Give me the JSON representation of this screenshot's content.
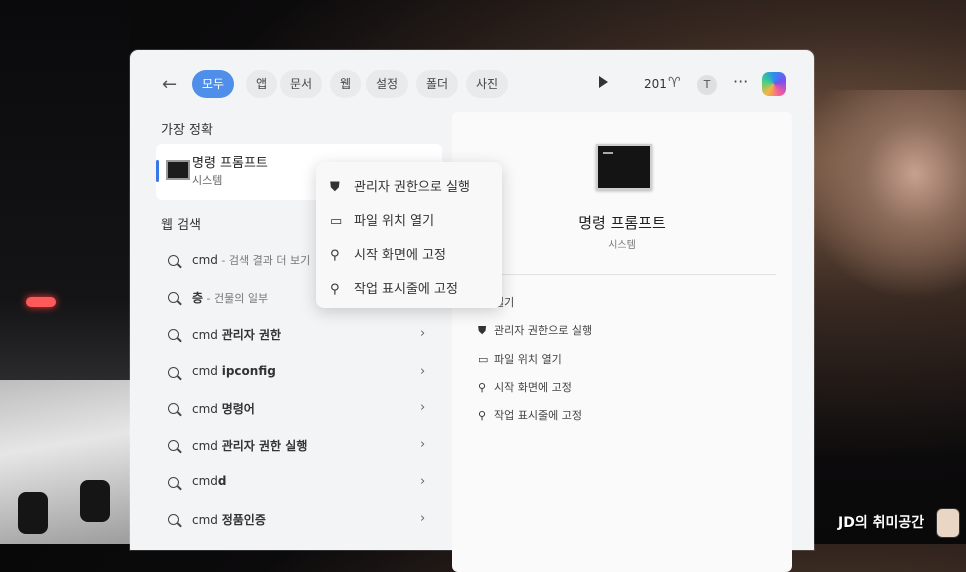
{
  "topbar": {
    "filters": [
      "모두",
      "앱",
      "문서",
      "웹",
      "설정",
      "폴더",
      "사진"
    ],
    "active_filter": "모두",
    "points": "201",
    "avatar_letter": "T"
  },
  "best_match": {
    "heading": "가장 정확",
    "name": "명령 프롬프트",
    "type": "시스템"
  },
  "web_search": {
    "heading": "웹 검색",
    "items": [
      {
        "prefix": "cmd",
        "bold": "",
        "hint": " - 검색 결과 더 보기"
      },
      {
        "prefix": "",
        "bold": "층",
        "hint": " - 건물의 일부"
      },
      {
        "prefix": "cmd ",
        "bold": "관리자 권한",
        "hint": ""
      },
      {
        "prefix": "cmd ",
        "bold": "ipconfig",
        "hint": ""
      },
      {
        "prefix": "cmd ",
        "bold": "명령어",
        "hint": ""
      },
      {
        "prefix": "cmd ",
        "bold": "관리자 권한 실행",
        "hint": ""
      },
      {
        "prefix": "cmd",
        "bold": "d",
        "hint": ""
      },
      {
        "prefix": "cmd ",
        "bold": "정품인증",
        "hint": ""
      }
    ]
  },
  "context_menu": {
    "items": [
      "관리자 권한으로 실행",
      "파일 위치 열기",
      "시작 화면에 고정",
      "작업 표시줄에 고정"
    ]
  },
  "details": {
    "title": "명령 프롬프트",
    "subtitle": "시스템",
    "actions": [
      "열기",
      "관리자 권한으로 실행",
      "파일 위치 열기",
      "시작 화면에 고정",
      "작업 표시줄에 고정"
    ]
  },
  "watermark": "JD의 취미공간",
  "icons": {
    "back": "arrow-left-icon",
    "play": "play-icon",
    "trophy": "trophy-icon",
    "more": "more-icon",
    "copilot": "copilot-icon",
    "search": "search-icon",
    "chevron": "chevron-right-icon",
    "shield": "shield-icon",
    "folder": "folder-icon",
    "pin": "pin-icon"
  },
  "colors": {
    "accent": "#4f8fe9",
    "selection_bar": "#3b78e7"
  }
}
